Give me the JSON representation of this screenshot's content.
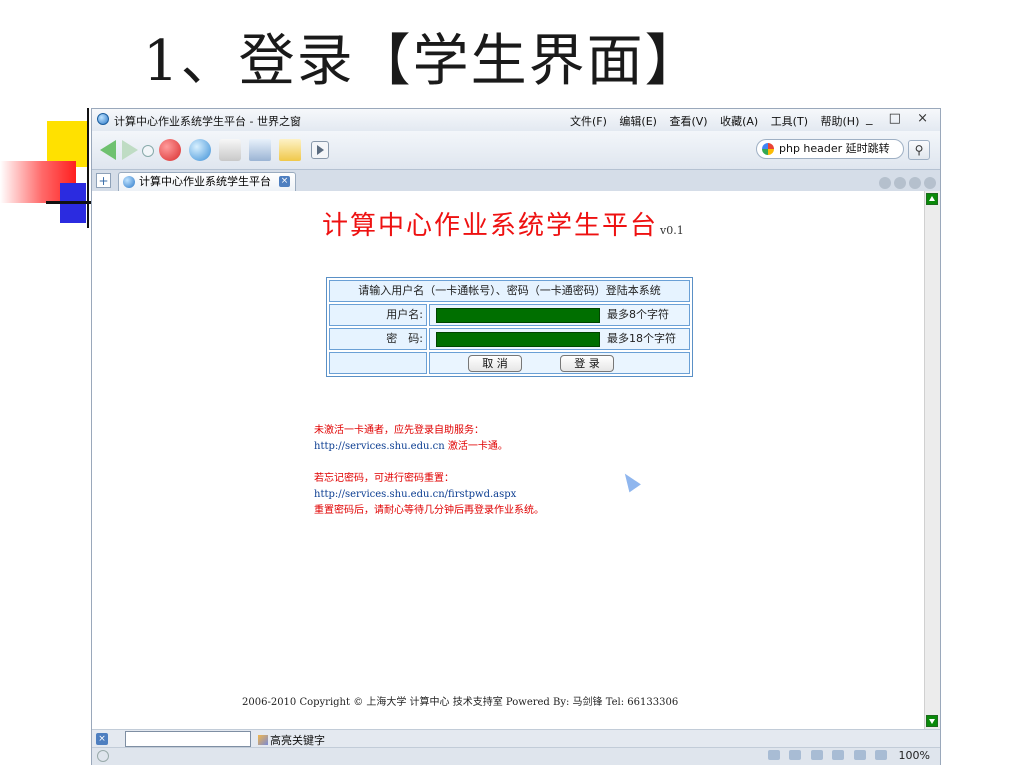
{
  "slide": {
    "title": "1、登录【学生界面】"
  },
  "window": {
    "title": "计算中心作业系统学生平台 - 世界之窗",
    "menus": [
      "文件(F)",
      "编辑(E)",
      "查看(V)",
      "收藏(A)",
      "工具(T)",
      "帮助(H)"
    ],
    "controls": "_ □ ×"
  },
  "toolbar": {
    "search_text": "php header 延时跳转"
  },
  "tabs": {
    "add": "+",
    "active_label": "计算中心作业系统学生平台",
    "close": "×"
  },
  "page": {
    "title": "计算中心作业系统学生平台",
    "version": "v0.1",
    "login": {
      "instruction": "请输入用户名（一卡通帐号）、密码（一卡通密码）登陆本系统",
      "username_label": "用户名:",
      "username_hint": "最多8个字符",
      "password_label": "密　码:",
      "password_hint": "最多18个字符",
      "cancel_label": "取 消",
      "submit_label": "登 录"
    },
    "notes": {
      "activate_text": "未激活一卡通者，应先登录自助服务：",
      "activate_url": "http://services.shu.edu.cn",
      "activate_suffix": " 激活一卡通。",
      "forgot_text": "若忘记密码，可进行密码重置：",
      "forgot_url": "http://services.shu.edu.cn/firstpwd.aspx",
      "reset_note": "重置密码后，请耐心等待几分钟后再登录作业系统。"
    },
    "footer": "2006-2010 Copyright © 上海大学 计算中心 技术支持室 Powered By: 马剑锋 Tel: 66133306"
  },
  "findbar": {
    "close": "×",
    "highlight_label": "高亮关键字"
  },
  "statusbar": {
    "zoom": "100%"
  }
}
